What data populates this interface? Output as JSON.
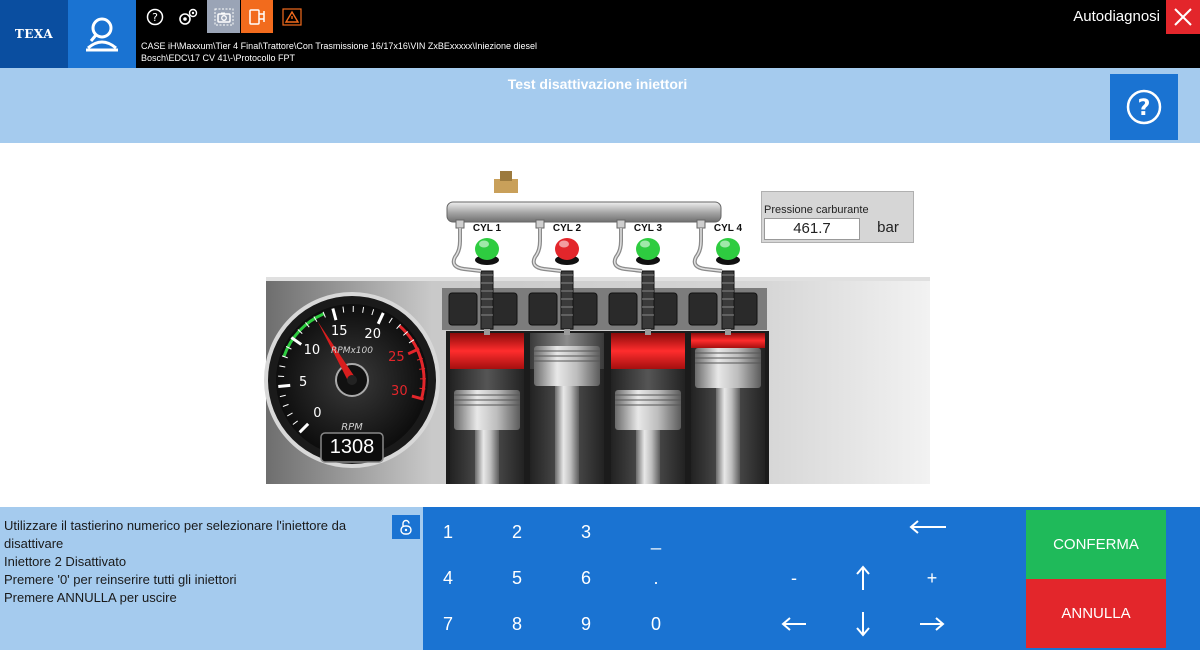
{
  "header": {
    "logo_text": "TEXA",
    "app_title": "Autodiagnosi",
    "breadcrumb_line1": "CASE iH\\Maxxum\\Tier 4 Final\\Trattore\\Con Trasmissione 16/17x16\\VIN ZxBExxxxx\\Iniezione diesel",
    "breadcrumb_line2": "Bosch\\EDC\\17 CV 41\\-\\Protocollo FPT",
    "toolbar_icons": [
      "help-icon",
      "settings-icon",
      "screenshot-icon",
      "tool-icon",
      "warning-icon"
    ]
  },
  "page": {
    "title": "Test disattivazione iniettori"
  },
  "engine": {
    "cylinders": [
      {
        "label": "CYL 1",
        "status": "active",
        "color": "#2ecc40"
      },
      {
        "label": "CYL 2",
        "status": "deactivated",
        "color": "#e3262b"
      },
      {
        "label": "CYL 3",
        "status": "active",
        "color": "#2ecc40"
      },
      {
        "label": "CYL 4",
        "status": "active",
        "color": "#2ecc40"
      }
    ],
    "pressure": {
      "label": "Pressione carburante",
      "value": "461.7",
      "unit": "bar"
    },
    "gauge": {
      "ticks": [
        "0",
        "5",
        "10",
        "15",
        "20",
        "25",
        "30"
      ],
      "unit_label": "RPMx100",
      "bottom_label": "RPM",
      "rpm_value": "1308",
      "rpm_numeric": 1308,
      "max_rpm_x100": 30
    }
  },
  "info": {
    "lines": [
      "Utilizzare il tastierino numerico per selezionare l'iniettore da disattivare",
      "Iniettore 2 Disattivato",
      "Premere '0' per reinserire tutti gli iniettori",
      "Premere ANNULLA per uscire"
    ]
  },
  "keypad": {
    "row1": [
      "1",
      "2",
      "3",
      "_"
    ],
    "row2": [
      "4",
      "5",
      "6",
      "."
    ],
    "row3": [
      "7",
      "8",
      "9",
      "0"
    ],
    "nav": {
      "minus": "-",
      "plus": "+"
    },
    "confirm": "CONFERMA",
    "cancel": "ANNULLA"
  },
  "colors": {
    "brand_blue": "#1a73d2",
    "light_blue": "#a5cbee",
    "confirm_green": "#1fba5a",
    "cancel_red": "#e3262b"
  }
}
